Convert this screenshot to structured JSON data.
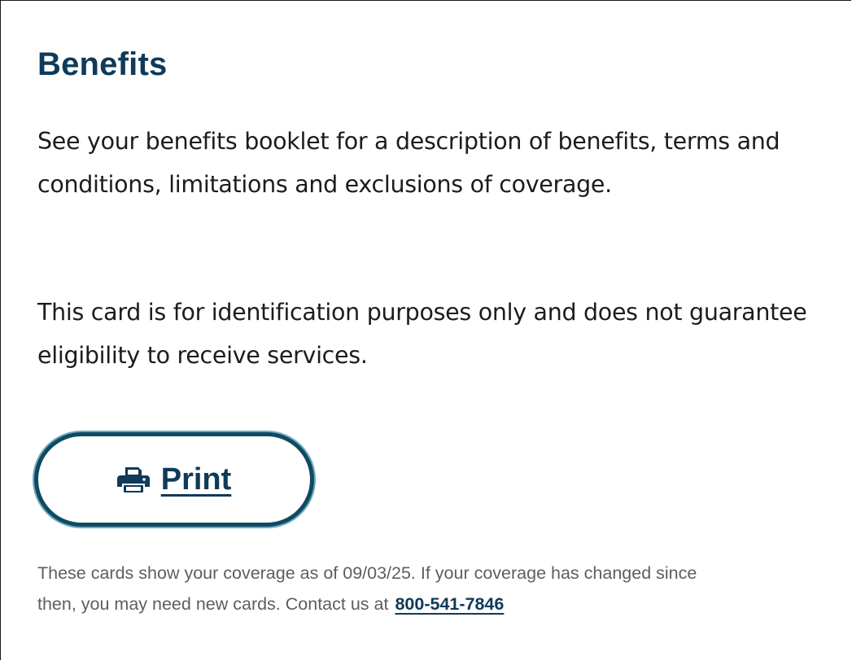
{
  "section": {
    "title": "Benefits",
    "paragraph_1": "See your benefits booklet for a description of benefits, terms and conditions, limitations and exclusions of coverage.",
    "paragraph_2": "This card is for identification purposes only and does not guarantee eligibility to receive services."
  },
  "print_button": {
    "label": "Print",
    "icon": "printer-icon"
  },
  "footer_note": {
    "line_1": "These cards show your coverage as of 09/03/25. If your coverage has changed since",
    "line_2": "then, you may need new cards. Contact us at",
    "phone": "800-541-7846"
  },
  "colors": {
    "heading": "#0f3a5a",
    "body_text": "#1c1c1c",
    "muted_text": "#5e5e5e",
    "button_border": "#0f4a63"
  }
}
